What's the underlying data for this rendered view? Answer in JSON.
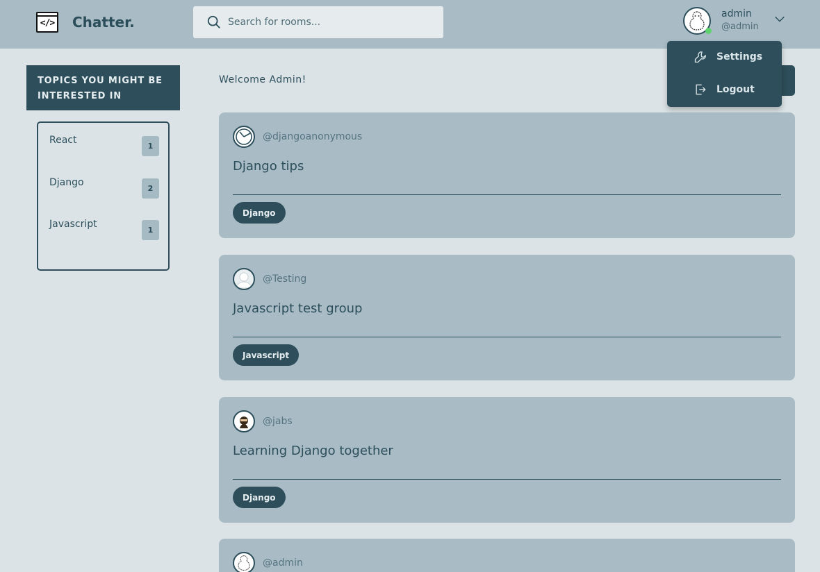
{
  "header": {
    "brand": "Chatter.",
    "search_placeholder": "Search for rooms...",
    "user": {
      "name": "admin",
      "handle": "@admin",
      "online": true
    }
  },
  "dropdown": {
    "items": [
      {
        "label": "Settings",
        "icon": "wrench-icon"
      },
      {
        "label": "Logout",
        "icon": "logout-icon"
      }
    ]
  },
  "sidebar": {
    "heading": "TOPICS YOU MIGHT BE INTERESTED IN",
    "topics": [
      {
        "name": "React",
        "count": "1"
      },
      {
        "name": "Django",
        "count": "2"
      },
      {
        "name": "Javascript",
        "count": "1"
      }
    ]
  },
  "main": {
    "welcome": "Welcome Admin!",
    "rooms": [
      {
        "host": "@djangoanonymous",
        "title": "Django tips",
        "topic": "Django",
        "avatar": "pacman-avatar"
      },
      {
        "host": "@Testing",
        "title": "Javascript test group",
        "topic": "Javascript",
        "avatar": "default-user-avatar"
      },
      {
        "host": "@jabs",
        "title": "Learning Django together",
        "topic": "Django",
        "avatar": "ninja-avatar"
      },
      {
        "host": "@admin",
        "title": "",
        "topic": "",
        "avatar": "sketch-avatar"
      }
    ]
  },
  "colors": {
    "header_bg": "#a9bcc6",
    "page_bg": "#dbe3e6",
    "accent_dark": "#2d4e5a",
    "card_bg": "#a9bcc6",
    "online": "#5dd46b"
  }
}
